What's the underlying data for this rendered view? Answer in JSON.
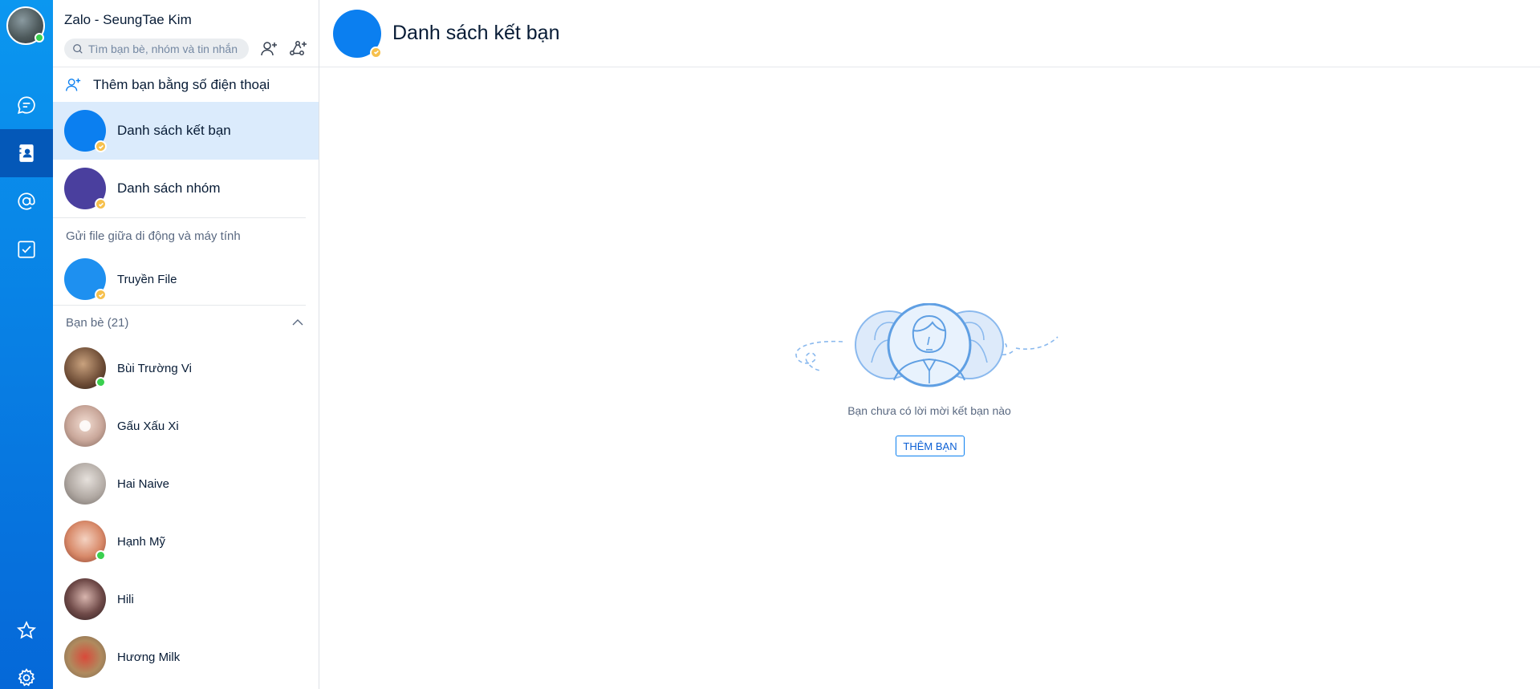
{
  "app": {
    "title": "Zalo - SeungTae Kim"
  },
  "rail": {
    "items": [
      {
        "icon": "chat-icon"
      },
      {
        "icon": "contacts-icon"
      },
      {
        "icon": "mention-icon"
      },
      {
        "icon": "todo-icon"
      },
      {
        "icon": "star-icon"
      },
      {
        "icon": "settings-icon"
      }
    ],
    "active": "contacts-icon"
  },
  "search": {
    "placeholder": "Tìm bạn bè, nhóm và tin nhắn"
  },
  "sidebar": {
    "add_by_phone": "Thêm bạn bằng số điện thoại",
    "menu": [
      {
        "label": "Danh sách kết bạn",
        "icon": "add-user-icon",
        "active": true
      },
      {
        "label": "Danh sách nhóm",
        "icon": "group-icon",
        "active": false
      }
    ],
    "file_caption": "Gửi file giữa di động và máy tính",
    "file_transfer": "Truyền File",
    "friends_header": "Bạn bè (21)",
    "friends": [
      {
        "name": "Bùi Trường Vi",
        "online": true
      },
      {
        "name": "Gấu Xấu Xi",
        "online": false
      },
      {
        "name": "Hai Naive",
        "online": false
      },
      {
        "name": "Hạnh Mỹ",
        "online": true
      },
      {
        "name": "Hili",
        "online": false
      },
      {
        "name": "Hương Milk",
        "online": false
      }
    ]
  },
  "main": {
    "title": "Danh sách kết bạn",
    "empty_text": "Bạn chưa có lời mời kết bạn nào",
    "add_button": "THÊM BẠN"
  },
  "colors": {
    "accent": "#0b7ff0",
    "rail_top": "#0b97f0",
    "rail_bottom": "#0568d8",
    "active_row": "#dbebfc",
    "online": "#3ad04f",
    "verified_badge": "#f6c04c",
    "group_avatar": "#4a3f9e"
  }
}
